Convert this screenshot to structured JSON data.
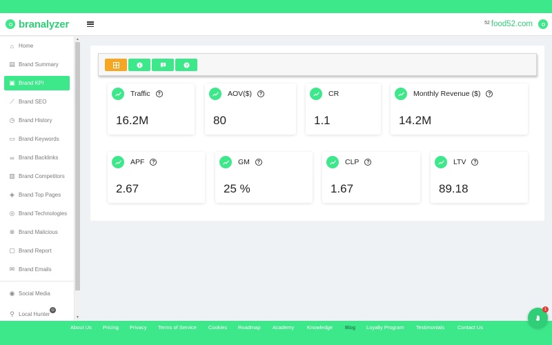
{
  "app": {
    "logo_text": "branalyzer",
    "site_name": "food52.com",
    "site_favicon_text": "52"
  },
  "sidebar": {
    "items": [
      {
        "label": "Home",
        "icon": "home-icon",
        "glyph": "⌂"
      },
      {
        "label": "Brand Summary",
        "icon": "summary-icon",
        "glyph": "▤"
      },
      {
        "label": "Brand KPI",
        "icon": "kpi-icon",
        "glyph": "▣",
        "active": true
      },
      {
        "label": "Brand SEO",
        "icon": "seo-icon",
        "glyph": "⟋"
      },
      {
        "label": "Brand History",
        "icon": "history-icon",
        "glyph": "◷"
      },
      {
        "label": "Brand Keywords",
        "icon": "keywords-icon",
        "glyph": "▭"
      },
      {
        "label": "Brand Backlinks",
        "icon": "backlinks-icon",
        "glyph": "∞"
      },
      {
        "label": "Brand Competitors",
        "icon": "competitors-icon",
        "glyph": "▥"
      },
      {
        "label": "Brand Top Pages",
        "icon": "layers-icon",
        "glyph": "◈"
      },
      {
        "label": "Brand Technologies",
        "icon": "technologies-icon",
        "glyph": "◎"
      },
      {
        "label": "Brand Malicious",
        "icon": "malicious-icon",
        "glyph": "⊗"
      },
      {
        "label": "Brand Report",
        "icon": "report-icon",
        "glyph": "▢"
      },
      {
        "label": "Brand Emails",
        "icon": "emails-icon",
        "glyph": "✉"
      }
    ],
    "extra": [
      {
        "label": "Social Media",
        "icon": "social-icon",
        "glyph": "◉"
      },
      {
        "label": "Local Hunter",
        "icon": "location-icon",
        "glyph": "⚲"
      }
    ]
  },
  "kpis_row1": [
    {
      "title": "Traffic",
      "value": "16.2M"
    },
    {
      "title": "AOV($)",
      "value": "80"
    },
    {
      "title": "CR",
      "value": "1.1"
    },
    {
      "title": "Monthly Revenue ($)",
      "value": "14.2M"
    }
  ],
  "kpis_row2": [
    {
      "title": "APF",
      "value": "2.67"
    },
    {
      "title": "GM",
      "value": "25 %"
    },
    {
      "title": "CLP",
      "value": "1.67"
    },
    {
      "title": "LTV",
      "value": "89.18"
    }
  ],
  "footer": {
    "links": [
      "About Us",
      "Pricing",
      "Privacy",
      "Terms of Service",
      "Cookies",
      "Roadmap",
      "Academy",
      "Knowledge",
      "Blog",
      "Loyalty Program",
      "Testimonials",
      "Contact Us"
    ]
  },
  "chat": {
    "badge": "1"
  },
  "colors": {
    "accent": "#3de88a",
    "active_tab": "#f5a623",
    "badge": "#e53935"
  }
}
